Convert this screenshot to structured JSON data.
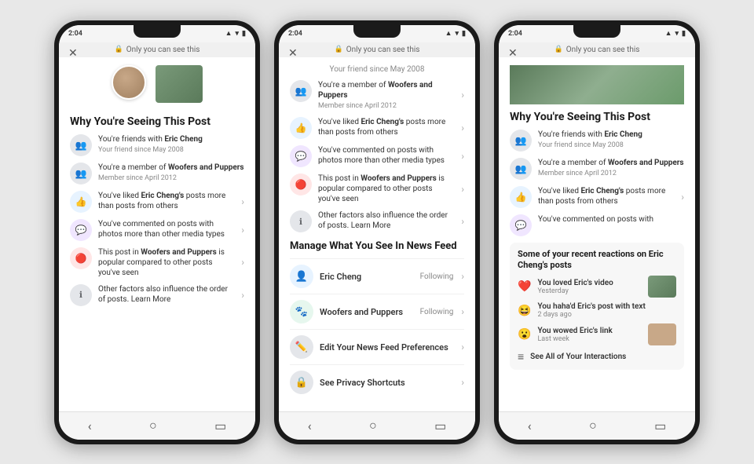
{
  "phones": [
    {
      "id": "phone1",
      "statusBar": {
        "time": "2:04",
        "signal": "▲▲▲",
        "wifi": "WiFi",
        "battery": "🔋"
      },
      "onlyYou": "Only you can see this",
      "section": {
        "title": "Why You're Seeing This Post",
        "reasons": [
          {
            "iconType": "gray",
            "iconSymbol": "👥",
            "text": "You're friends with <strong>Eric Cheng</strong>",
            "subtext": "Your friend since May 2008",
            "hasChevron": false
          },
          {
            "iconType": "gray",
            "iconSymbol": "👥",
            "text": "You're a member of <strong>Woofers and Puppers</strong>",
            "subtext": "Member since April 2012",
            "hasChevron": false
          },
          {
            "iconType": "blue",
            "iconSymbol": "👍",
            "text": "You've liked <strong>Eric Cheng's</strong> posts more than posts from others",
            "hasChevron": true
          },
          {
            "iconType": "purple",
            "iconSymbol": "💬",
            "text": "You've commented on posts with photos more than other media types",
            "hasChevron": true
          },
          {
            "iconType": "red",
            "iconSymbol": "🔥",
            "text": "This post in <strong>Woofers and Puppers</strong> is popular compared to other posts you've seen",
            "hasChevron": true
          },
          {
            "iconType": "gray",
            "iconSymbol": "ℹ",
            "text": "Other factors also influence the order of posts. Learn More",
            "hasChevron": true
          }
        ]
      }
    },
    {
      "id": "phone2",
      "statusBar": {
        "time": "2:04"
      },
      "onlyYou": "Only you can see this",
      "friendSince": "Your friend since May 2008",
      "reasons": [
        {
          "iconType": "gray",
          "iconSymbol": "👥",
          "text": "You're a member of <strong>Woofers and Puppers</strong>",
          "subtext": "Member since April 2012",
          "hasChevron": true
        },
        {
          "iconType": "blue",
          "iconSymbol": "👍",
          "text": "You've liked <strong>Eric Cheng's</strong> posts more than posts from others",
          "hasChevron": true
        },
        {
          "iconType": "purple",
          "iconSymbol": "💬",
          "text": "You've commented on posts with photos more than other media types",
          "hasChevron": true
        },
        {
          "iconType": "red",
          "iconSymbol": "🔥",
          "text": "This post in <strong>Woofers and Puppers</strong> is popular compared to other posts you've seen",
          "hasChevron": true
        },
        {
          "iconType": "gray",
          "iconSymbol": "ℹ",
          "text": "Other factors also influence the order of posts. Learn More",
          "hasChevron": true
        }
      ],
      "manage": {
        "title": "Manage What You See In News Feed",
        "items": [
          {
            "iconType": "blue",
            "iconSymbol": "👤",
            "label": "Eric Cheng",
            "badge": "Following",
            "hasChevron": true
          },
          {
            "iconType": "green",
            "iconSymbol": "🐾",
            "label": "Woofers and Puppers",
            "badge": "Following",
            "hasChevron": true
          },
          {
            "iconType": "gray",
            "iconSymbol": "✏",
            "label": "Edit Your News Feed Preferences",
            "badge": "",
            "hasChevron": true
          },
          {
            "iconType": "gray",
            "iconSymbol": "🔒",
            "label": "See Privacy Shortcuts",
            "badge": "",
            "hasChevron": true
          }
        ]
      }
    },
    {
      "id": "phone3",
      "statusBar": {
        "time": "2:04"
      },
      "onlyYou": "Only you can see this",
      "section": {
        "title": "Why You're Seeing This Post",
        "reasons": [
          {
            "iconType": "gray",
            "iconSymbol": "👥",
            "text": "You're friends with <strong>Eric Cheng</strong>",
            "subtext": "Your friend since May 2008",
            "hasChevron": false
          },
          {
            "iconType": "gray",
            "iconSymbol": "👥",
            "text": "You're a member of <strong>Woofers and Puppers</strong>",
            "subtext": "Member since April 2012",
            "hasChevron": false
          },
          {
            "iconType": "blue",
            "iconSymbol": "👍",
            "text": "You've liked <strong>Eric Cheng's</strong> posts more than posts from others",
            "hasChevron": true
          },
          {
            "iconType": "purple",
            "iconSymbol": "💬",
            "text": "You've commented on posts with",
            "hasChevron": false
          }
        ]
      },
      "reactions": {
        "title": "Some of your recent reactions on Eric Cheng's posts",
        "items": [
          {
            "emoji": "❤️",
            "text": "You loved Eric's video",
            "time": "Yesterday",
            "hasThumb": true,
            "thumbColor": "green"
          },
          {
            "emoji": "😆",
            "text": "You haha'd Eric's post with text",
            "time": "2 days ago",
            "hasThumb": false
          },
          {
            "emoji": "😮",
            "text": "You wowed Eric's link",
            "time": "Last week",
            "hasThumb": true,
            "thumbColor": "brown"
          }
        ],
        "seeAll": "See All of Your Interactions"
      }
    }
  ]
}
